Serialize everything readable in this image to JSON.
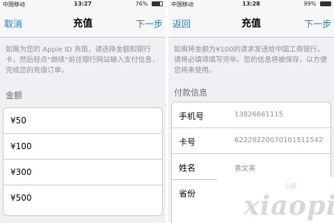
{
  "left": {
    "status": {
      "carrier": "中国移动",
      "time": "13:27",
      "battery": "76%"
    },
    "nav": {
      "left": "取消",
      "title": "充值",
      "right": "下一步"
    },
    "description": "如需为您的 Apple ID 充值，请选择金额和银行卡，然后轻点“继续”前往银行网站输入支付信息，完成您的充值订单。",
    "section": "金额",
    "amounts": [
      "¥50",
      "¥100",
      "¥300",
      "¥500"
    ]
  },
  "right": {
    "status": {
      "carrier": "中国移动",
      "time": "13:28",
      "battery": "99%"
    },
    "nav": {
      "left": "返回",
      "title": "充值",
      "right": "下一步"
    },
    "description": "如需将金额为¥100的请求发送给中国工商银行，请将必填项填写完毕。您的信息将被保存，以方便您将来使用。",
    "section": "付款信息",
    "fields": [
      {
        "label": "手机号",
        "value": "13826661115"
      },
      {
        "label": "卡号",
        "value": "62220220070101511542"
      },
      {
        "label": "姓名",
        "value": "袁文美"
      },
      {
        "label": "省份",
        "value": ""
      }
    ]
  },
  "watermark": {
    "main": "xiaopi",
    "small": "小皮"
  }
}
